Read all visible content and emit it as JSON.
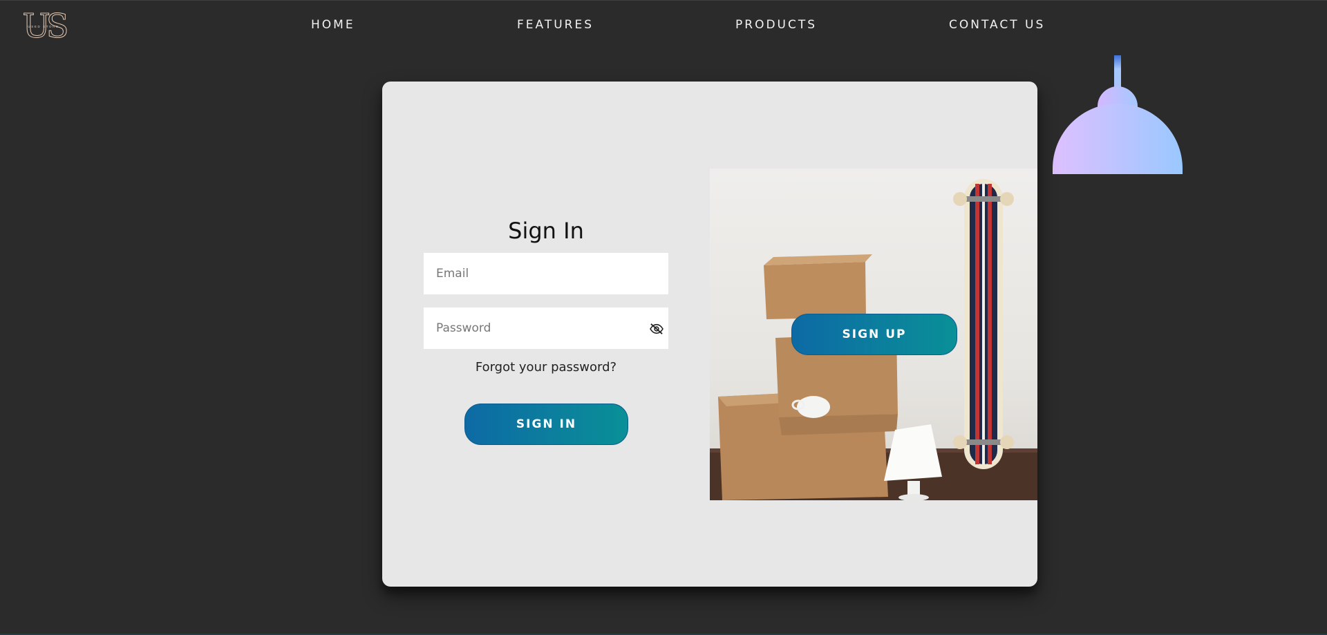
{
  "header": {
    "logo_text": "US",
    "logo_subtext": "USED STORE",
    "nav": {
      "home": "HOME",
      "features": "FEATURES",
      "products": "PRODUCTS",
      "contact": "CONTACT US"
    }
  },
  "signin": {
    "title": "Sign In",
    "email_placeholder": "Email",
    "password_placeholder": "Password",
    "forgot_label": "Forgot your password?",
    "button_label": "SIGN IN"
  },
  "overlay": {
    "button_label": "SIGN UP"
  },
  "colors": {
    "background": "#2b2b2b",
    "card": "#e7e7e7",
    "button_gradient_start": "#0d6aa5",
    "button_gradient_end": "#0a9097",
    "lamp_gradient_start": "#dec0ff",
    "lamp_gradient_end": "#9ac8ff",
    "logo": "#e9c9b0"
  },
  "icons": {
    "password_toggle": "eye-slash-icon"
  }
}
